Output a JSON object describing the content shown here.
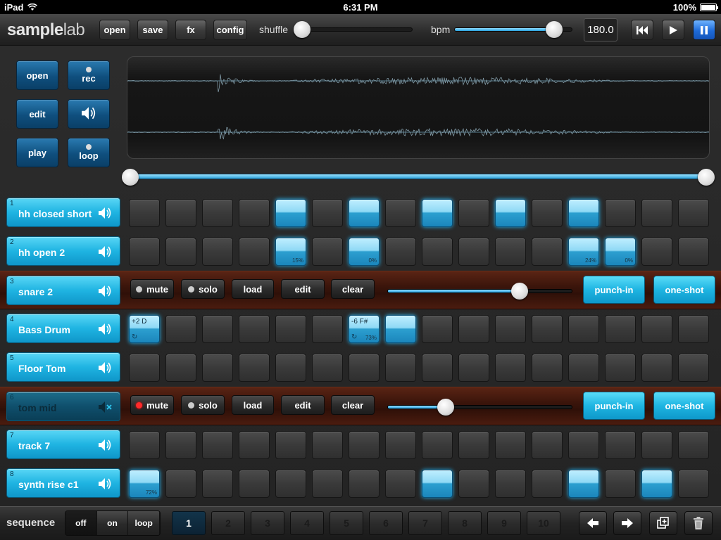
{
  "status": {
    "device": "iPad",
    "time": "6:31 PM",
    "battery": "100%"
  },
  "toolbar": {
    "logo_a": "sample",
    "logo_b": "lab",
    "buttons": [
      "open",
      "save",
      "fx",
      "config"
    ],
    "shuffle_label": "shuffle",
    "shuffle_level": 0.05,
    "bpm_label": "bpm",
    "bpm_level": 0.84,
    "bpm_value": "180.0",
    "transport": [
      "rewind-icon",
      "play-icon",
      "pause-icon"
    ]
  },
  "sample_panel": {
    "buttons": [
      {
        "label": "open"
      },
      {
        "label": "rec",
        "dot": true
      },
      {
        "label": "edit"
      },
      {
        "label": "",
        "icon": "speaker-wave-icon"
      },
      {
        "label": "play"
      },
      {
        "label": "loop",
        "dot": true
      }
    ]
  },
  "tracks": [
    {
      "num": "1",
      "name": "hh closed short",
      "muted": false,
      "steps": [
        {},
        {},
        {},
        {},
        {
          "on": true
        },
        {},
        {
          "on": true
        },
        {},
        {
          "on": true
        },
        {},
        {
          "on": true
        },
        {},
        {
          "on": true
        },
        {},
        {},
        {}
      ]
    },
    {
      "num": "2",
      "name": "hh open 2",
      "muted": false,
      "steps": [
        {},
        {},
        {},
        {},
        {
          "on": true,
          "pct": "15%"
        },
        {},
        {
          "on": true,
          "pct": "0%"
        },
        {},
        {},
        {},
        {},
        {},
        {
          "on": true,
          "pct": "24%"
        },
        {
          "on": true,
          "pct": "0%"
        },
        {},
        {}
      ]
    },
    {
      "num": "3",
      "name": "snare 2",
      "muted": false,
      "panel": true,
      "panel_data": {
        "mute": "mute",
        "solo": "solo",
        "load": "load",
        "edit": "edit",
        "clear": "clear",
        "mute_active": false,
        "volume": 0.71,
        "punch": "punch-in",
        "oneshot": "one-shot"
      }
    },
    {
      "num": "4",
      "name": "Bass Drum",
      "muted": false,
      "steps": [
        {
          "on": true,
          "note": "+2 D",
          "loop": true
        },
        {},
        {},
        {},
        {},
        {},
        {
          "on": true,
          "note": "-6 F#",
          "loop": true,
          "pct": "73%"
        },
        {
          "on": true
        },
        {},
        {},
        {},
        {},
        {},
        {},
        {},
        {}
      ]
    },
    {
      "num": "5",
      "name": "Floor Tom",
      "muted": false,
      "steps": [
        {},
        {},
        {},
        {},
        {},
        {},
        {},
        {},
        {},
        {},
        {},
        {},
        {},
        {},
        {},
        {}
      ]
    },
    {
      "num": "6",
      "name": "tom mid",
      "muted": true,
      "panel": true,
      "panel_data": {
        "mute": "mute",
        "solo": "solo",
        "load": "load",
        "edit": "edit",
        "clear": "clear",
        "mute_active": true,
        "volume": 0.31,
        "punch": "punch-in",
        "oneshot": "one-shot"
      }
    },
    {
      "num": "7",
      "name": "track 7",
      "muted": false,
      "steps": [
        {},
        {},
        {},
        {},
        {},
        {},
        {},
        {},
        {},
        {},
        {},
        {},
        {},
        {},
        {},
        {}
      ]
    },
    {
      "num": "8",
      "name": "synth rise c1",
      "muted": false,
      "steps": [
        {
          "on": true,
          "pct": "72%"
        },
        {},
        {},
        {},
        {},
        {},
        {},
        {},
        {
          "on": true
        },
        {},
        {},
        {},
        {
          "on": true
        },
        {},
        {
          "on": true
        },
        {}
      ]
    }
  ],
  "bottom": {
    "sequence_label": "sequence",
    "modes": [
      "off",
      "on",
      "loop"
    ],
    "mode_selected": 0,
    "patterns": [
      "1",
      "2",
      "3",
      "4",
      "5",
      "6",
      "7",
      "8",
      "9",
      "10"
    ],
    "pattern_selected": 0,
    "actions": [
      "arrow-left-icon",
      "arrow-right-icon",
      "duplicate-icon",
      "trash-icon"
    ]
  },
  "colors": {
    "accent": "#1fb4e2",
    "panel": "#3b150b",
    "active_transport": "#1e6ad8"
  }
}
